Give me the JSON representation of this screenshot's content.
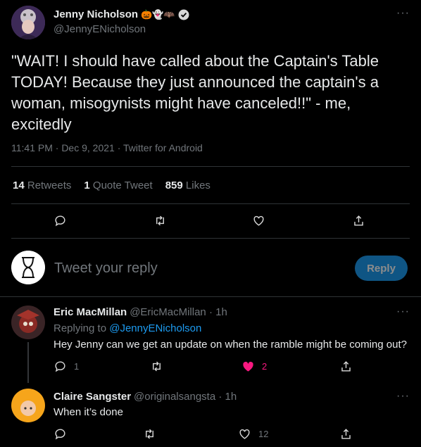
{
  "main_tweet": {
    "display_name": "Jenny Nicholson",
    "name_emojis": "🎃👻🦇",
    "handle": "@JennyENicholson",
    "text_lines": [
      "\"WAIT! I should have called about the Captain's Table",
      "TODAY! Because they just announced the captain's a",
      "woman, misogynists might have canceled!!\" - me,",
      "excitedly"
    ],
    "timestamp": "11:41 PM · Dec 9, 2021 · Twitter for Android",
    "stats": {
      "retweets_count": "14",
      "retweets_label": "Retweets",
      "quotes_count": "1",
      "quotes_label": "Quote Tweet",
      "likes_count": "859",
      "likes_label": "Likes"
    }
  },
  "composer": {
    "placeholder": "Tweet your reply",
    "button_label": "Reply"
  },
  "replies": [
    {
      "display_name": "Eric MacMillan",
      "handle_time": "@EricMacMillan · 1h",
      "replying_prefix": "Replying to",
      "replying_handle": "@JennyENicholson",
      "text": "Hey Jenny can we get an update on when the ramble might be coming out?",
      "reply_count": "1",
      "retweet_count": "",
      "like_count": "2",
      "liked": true
    },
    {
      "display_name": "Claire Sangster",
      "handle_time": "@originalsangsta · 1h",
      "text": "When it’s done",
      "reply_count": "",
      "retweet_count": "",
      "like_count": "12",
      "liked": false
    }
  ],
  "colors": {
    "accent": "#1d9bf0",
    "like_pink": "#f91880",
    "background": "#000000"
  }
}
